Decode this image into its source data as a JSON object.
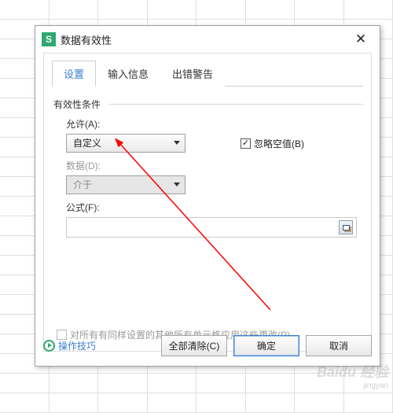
{
  "dialog": {
    "title": "数据有效性",
    "tabs": {
      "settings": "设置",
      "input_msg": "输入信息",
      "error_alert": "出错警告"
    },
    "group_label": "有效性条件",
    "allow_label": "允许(A):",
    "allow_value": "自定义",
    "ignore_blank_label": "忽略空值(B)",
    "ignore_blank_checked": "✓",
    "data_label": "数据(D):",
    "data_value": "介于",
    "formula_label": "公式(F):",
    "apply_all_label": "对所有有同样设置的其他所有单元格应用这些更改(P)",
    "tips_label": "操作技巧",
    "buttons": {
      "clear": "全部清除(C)",
      "ok": "确定",
      "cancel": "取消"
    }
  },
  "watermark": {
    "brand": "Baidu 经验",
    "sub": "jingyan"
  }
}
